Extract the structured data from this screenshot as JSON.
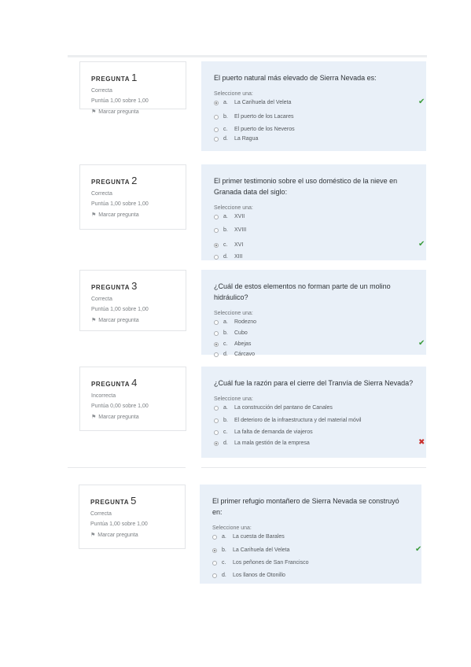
{
  "questions": [
    {
      "title": "PREGUNTA",
      "number": "1",
      "state": "Correcta",
      "grade": "Puntúa 1,00 sobre 1,00",
      "flag": "Marcar pregunta",
      "text": "El puerto natural más elevado de Sierra Nevada es:",
      "prompt": "Seleccione una:",
      "options": [
        {
          "letter": "a.",
          "text": "La Carihuela del Veleta",
          "selected": true,
          "mark": "check-icon"
        },
        {
          "letter": "b.",
          "text": "El puerto de los Lacares",
          "selected": false,
          "mark": ""
        },
        {
          "letter": "c.",
          "text": "El puerto de los Neveros",
          "selected": false,
          "mark": ""
        },
        {
          "letter": "d.",
          "text": "La Ragua",
          "selected": false,
          "mark": ""
        }
      ]
    },
    {
      "title": "PREGUNTA",
      "number": "2",
      "state": "Correcta",
      "grade": "Puntúa 1,00 sobre 1,00",
      "flag": "Marcar pregunta",
      "text": "El primer testimonio sobre el uso doméstico de la nieve en Granada data del siglo:",
      "prompt": "Seleccione una:",
      "options": [
        {
          "letter": "a.",
          "text": "XVII",
          "selected": false,
          "mark": ""
        },
        {
          "letter": "b.",
          "text": "XVIII",
          "selected": false,
          "mark": ""
        },
        {
          "letter": "c.",
          "text": "XVI",
          "selected": true,
          "mark": "check-icon"
        },
        {
          "letter": "d.",
          "text": "XIII",
          "selected": false,
          "mark": ""
        }
      ]
    },
    {
      "title": "PREGUNTA",
      "number": "3",
      "state": "Correcta",
      "grade": "Puntúa 1,00 sobre 1,00",
      "flag": "Marcar pregunta",
      "text": "¿Cuál de estos elementos no forman parte de un molino hidráulico?",
      "prompt": "Seleccione una:",
      "options": [
        {
          "letter": "a.",
          "text": "Rodezno",
          "selected": false,
          "mark": ""
        },
        {
          "letter": "b.",
          "text": "Cubo",
          "selected": false,
          "mark": ""
        },
        {
          "letter": "c.",
          "text": "Abejas",
          "selected": true,
          "mark": "check-icon"
        },
        {
          "letter": "d.",
          "text": "Cárcavo",
          "selected": false,
          "mark": ""
        }
      ]
    },
    {
      "title": "PREGUNTA",
      "number": "4",
      "state": "Incorrecta",
      "grade": "Puntúa 0,00 sobre 1,00",
      "flag": "Marcar pregunta",
      "text": "¿Cuál fue la razón para el cierre del Tranvía de Sierra Nevada?",
      "prompt": "Seleccione una:",
      "options": [
        {
          "letter": "a.",
          "text": "La construcción del pantano de Canales",
          "selected": false,
          "mark": ""
        },
        {
          "letter": "b.",
          "text": "El deterioro de la infraestructura y del material móvil",
          "selected": false,
          "mark": ""
        },
        {
          "letter": "c.",
          "text": "La falta de demanda de viajeros",
          "selected": false,
          "mark": ""
        },
        {
          "letter": "d.",
          "text": "La mala gestión de la empresa",
          "selected": true,
          "mark": "cross-icon"
        }
      ]
    },
    {
      "title": "PREGUNTA",
      "number": "5",
      "state": "Correcta",
      "grade": "Puntúa 1,00 sobre 1,00",
      "flag": "Marcar pregunta",
      "text": "El primer refugio montañero de Sierra Nevada se construyó en:",
      "prompt": "Seleccione una:",
      "options": [
        {
          "letter": "a.",
          "text": "La cuesta de Barales",
          "selected": false,
          "mark": ""
        },
        {
          "letter": "b.",
          "text": "La Carihuela del Veleta",
          "selected": true,
          "mark": "check-icon"
        },
        {
          "letter": "c.",
          "text": "Los peñones de San Francisco",
          "selected": false,
          "mark": ""
        },
        {
          "letter": "d.",
          "text": "Los llanos de Otonillo",
          "selected": false,
          "mark": ""
        }
      ]
    }
  ],
  "colors": {
    "content_bg": "#e9f0f8",
    "correct": "#3a9b3a",
    "incorrect": "#c9302c"
  }
}
